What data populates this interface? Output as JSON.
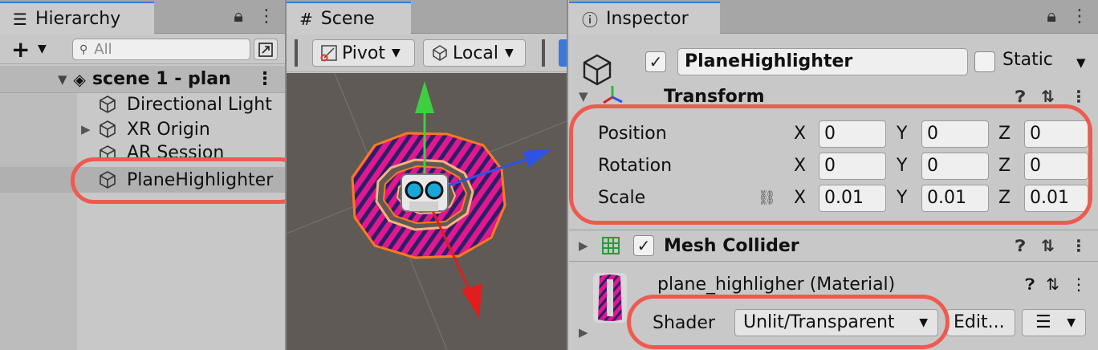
{
  "hierarchy": {
    "tab_label": "Hierarchy",
    "search_placeholder": "All",
    "scene_name": "scene 1 - plan",
    "items": [
      {
        "label": "Directional Light"
      },
      {
        "label": "XR Origin"
      },
      {
        "label": "AR Session"
      },
      {
        "label": "PlaneHighlighter"
      }
    ]
  },
  "scene": {
    "tab_label": "Scene",
    "pivot_label": "Pivot",
    "local_label": "Local"
  },
  "inspector": {
    "tab_label": "Inspector",
    "object_name": "PlaneHighlighter",
    "static_label": "Static",
    "transform_title": "Transform",
    "position_label": "Position",
    "rotation_label": "Rotation",
    "scale_label": "Scale",
    "axis_x": "X",
    "axis_y": "Y",
    "axis_z": "Z",
    "position": {
      "x": "0",
      "y": "0",
      "z": "0"
    },
    "rotation": {
      "x": "0",
      "y": "0",
      "z": "0"
    },
    "scale": {
      "x": "0.01",
      "y": "0.01",
      "z": "0.01"
    },
    "mesh_collider_title": "Mesh Collider",
    "material_name": "plane_highligher (Material)",
    "shader_label": "Shader",
    "shader_value": "Unlit/Transparent",
    "edit_label": "Edit..."
  },
  "colors": {
    "annotation": "#ef5a50",
    "selection_blue": "#3a79d9",
    "viewport_bg": "#5f5a56"
  }
}
